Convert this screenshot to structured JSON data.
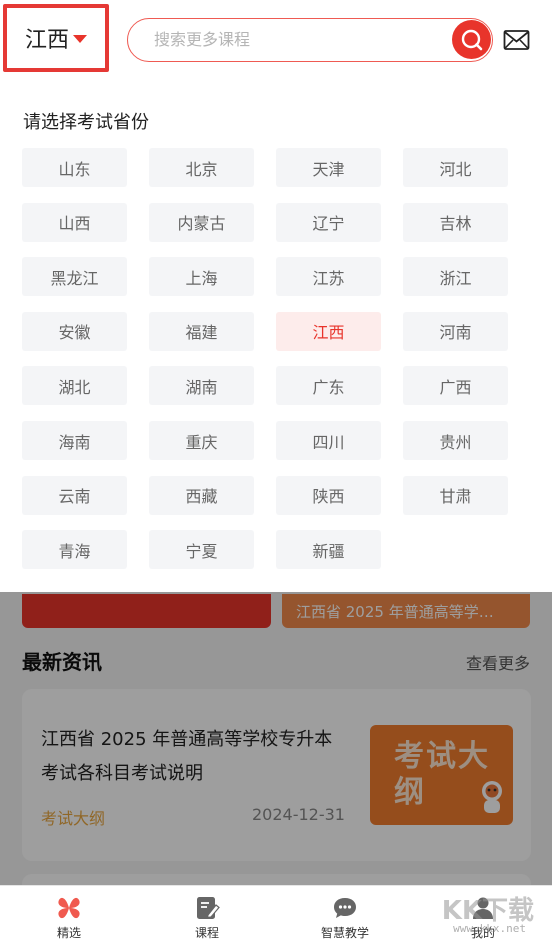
{
  "header": {
    "province": "江西",
    "search_placeholder": "搜索更多课程"
  },
  "dropdown": {
    "title": "请选择考试省份",
    "selected": "江西",
    "provinces": [
      "山东",
      "北京",
      "天津",
      "河北",
      "山西",
      "内蒙古",
      "辽宁",
      "吉林",
      "黑龙江",
      "上海",
      "江苏",
      "浙江",
      "安徽",
      "福建",
      "江西",
      "河南",
      "湖北",
      "湖南",
      "广东",
      "广西",
      "海南",
      "重庆",
      "四川",
      "贵州",
      "云南",
      "西藏",
      "陕西",
      "甘肃",
      "青海",
      "宁夏",
      "新疆"
    ]
  },
  "banner": {
    "right_text": "江西省 2025 年普通高等学…"
  },
  "news": {
    "section_title": "最新资讯",
    "more_label": "查看更多",
    "item": {
      "title": "江西省 2025 年普通高等学校专升本考试各科目考试说明",
      "tag": "考试大纲",
      "date": "2024-12-31",
      "thumb_text": "考试大纲"
    }
  },
  "tabbar": {
    "items": [
      {
        "label": "精选",
        "icon": "selected-grid-icon"
      },
      {
        "label": "课程",
        "icon": "course-edit-icon"
      },
      {
        "label": "智慧教学",
        "icon": "chat-bubble-icon"
      },
      {
        "label": "我的",
        "icon": "user-icon"
      }
    ]
  },
  "watermark": {
    "text": "KK下载",
    "url": "www.kkx.net"
  },
  "colors": {
    "accent": "#e8342b",
    "selected_bg": "#fdeceb",
    "chip_bg": "#f4f5f7",
    "tag": "#e8a640",
    "banner_orange": "#f08a4b"
  }
}
